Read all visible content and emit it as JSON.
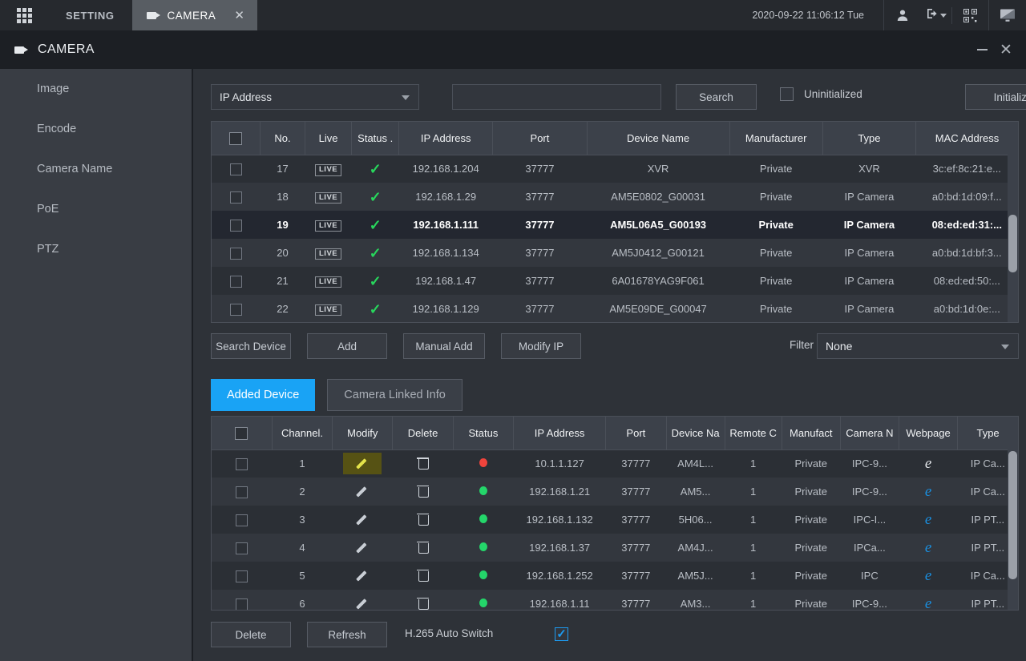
{
  "appbar": {
    "grid_icon": "grid-apps-icon",
    "setting_label": "SETTING",
    "camera_tab_label": "CAMERA",
    "camera_tab_icon": "video-camera-icon",
    "tab_close": "✕",
    "clock": "2020-09-22 11:06:12 Tue",
    "icons": [
      "user-icon",
      "logout-icon",
      "qrcode-icon",
      "display-icon"
    ]
  },
  "window": {
    "title": "CAMERA",
    "title_icon": "video-camera-icon",
    "minimize": "–",
    "close": "✕"
  },
  "sidebar": {
    "items": [
      {
        "label": "Image"
      },
      {
        "label": "Encode"
      },
      {
        "label": "Camera Name"
      },
      {
        "label": "PoE"
      },
      {
        "label": "PTZ"
      }
    ]
  },
  "search": {
    "mode_value": "IP Address",
    "input_value": "",
    "input_placeholder": "",
    "search_label": "Search",
    "uninitialized_label": "Uninitialized",
    "uninitialized_checked": false,
    "initialize_label": "Initialize"
  },
  "device_table": {
    "headers": [
      "",
      "No.",
      "Live",
      "Status .",
      "IP Address",
      "Port",
      "Device Name",
      "Manufacturer",
      "Type",
      "MAC Address"
    ],
    "rows": [
      {
        "no": "17",
        "live": "LIVE",
        "status": "✓",
        "ip": "192.168.1.204",
        "port": "37777",
        "device_name": "XVR",
        "manufacturer": "Private",
        "type": "XVR",
        "mac": "3c:ef:8c:21:e...",
        "selected": false
      },
      {
        "no": "18",
        "live": "LIVE",
        "status": "✓",
        "ip": "192.168.1.29",
        "port": "37777",
        "device_name": "AM5E0802_G00031",
        "manufacturer": "Private",
        "type": "IP Camera",
        "mac": "a0:bd:1d:09:f...",
        "selected": false
      },
      {
        "no": "19",
        "live": "LIVE",
        "status": "✓",
        "ip": "192.168.1.111",
        "port": "37777",
        "device_name": "AM5L06A5_G00193",
        "manufacturer": "Private",
        "type": "IP Camera",
        "mac": "08:ed:ed:31:...",
        "selected": true
      },
      {
        "no": "20",
        "live": "LIVE",
        "status": "✓",
        "ip": "192.168.1.134",
        "port": "37777",
        "device_name": "AM5J0412_G00121",
        "manufacturer": "Private",
        "type": "IP Camera",
        "mac": "a0:bd:1d:bf:3...",
        "selected": false
      },
      {
        "no": "21",
        "live": "LIVE",
        "status": "✓",
        "ip": "192.168.1.47",
        "port": "37777",
        "device_name": "6A01678YAG9F061",
        "manufacturer": "Private",
        "type": "IP Camera",
        "mac": "08:ed:ed:50:...",
        "selected": false
      },
      {
        "no": "22",
        "live": "LIVE",
        "status": "✓",
        "ip": "192.168.1.129",
        "port": "37777",
        "device_name": "AM5E09DE_G00047",
        "manufacturer": "Private",
        "type": "IP Camera",
        "mac": "a0:bd:1d:0e:...",
        "selected": false
      }
    ]
  },
  "mid_toolbar": {
    "search_device_label": "Search Device",
    "add_label": "Add",
    "manual_add_label": "Manual Add",
    "modify_ip_label": "Modify IP",
    "filter_label": "Filter",
    "filter_value": "None"
  },
  "tabs": {
    "added_device_label": "Added Device",
    "camera_linked_info_label": "Camera Linked Info",
    "active": "Added Device"
  },
  "added_table": {
    "headers": [
      "",
      "Channel.",
      "Modify",
      "Delete",
      "Status",
      "IP Address",
      "Port",
      "Device Na",
      "Remote C",
      "Manufact",
      "Camera N",
      "Webpage",
      "Type"
    ],
    "rows": [
      {
        "channel": "1",
        "modify": "pencil",
        "modify_highlight": true,
        "delete": "trash",
        "status": "red",
        "ip": "10.1.1.127",
        "port": "37777",
        "device_name": "AM4L...",
        "remote_ch": "1",
        "manufacturer": "Private",
        "camera_name": "IPC-9...",
        "webpage": "e",
        "webpage_color": "white",
        "type": "IP Ca..."
      },
      {
        "channel": "2",
        "modify": "pencil",
        "modify_highlight": false,
        "delete": "trash",
        "status": "green",
        "ip": "192.168.1.21",
        "port": "37777",
        "device_name": "AM5...",
        "remote_ch": "1",
        "manufacturer": "Private",
        "camera_name": "IPC-9...",
        "webpage": "e",
        "webpage_color": "blue",
        "type": "IP Ca..."
      },
      {
        "channel": "3",
        "modify": "pencil",
        "modify_highlight": false,
        "delete": "trash",
        "status": "green",
        "ip": "192.168.1.132",
        "port": "37777",
        "device_name": "5H06...",
        "remote_ch": "1",
        "manufacturer": "Private",
        "camera_name": "IPC-I...",
        "webpage": "e",
        "webpage_color": "blue",
        "type": "IP PT..."
      },
      {
        "channel": "4",
        "modify": "pencil",
        "modify_highlight": false,
        "delete": "trash",
        "status": "green",
        "ip": "192.168.1.37",
        "port": "37777",
        "device_name": "AM4J...",
        "remote_ch": "1",
        "manufacturer": "Private",
        "camera_name": "IPCa...",
        "webpage": "e",
        "webpage_color": "blue",
        "type": "IP PT..."
      },
      {
        "channel": "5",
        "modify": "pencil",
        "modify_highlight": false,
        "delete": "trash",
        "status": "green",
        "ip": "192.168.1.252",
        "port": "37777",
        "device_name": "AM5J...",
        "remote_ch": "1",
        "manufacturer": "Private",
        "camera_name": "IPC",
        "webpage": "e",
        "webpage_color": "blue",
        "type": "IP Ca..."
      },
      {
        "channel": "6",
        "modify": "pencil",
        "modify_highlight": false,
        "delete": "trash",
        "status": "green",
        "ip": "192.168.1.11",
        "port": "37777",
        "device_name": "AM3...",
        "remote_ch": "1",
        "manufacturer": "Private",
        "camera_name": "IPC-9...",
        "webpage": "e",
        "webpage_color": "blue",
        "type": "IP PT..."
      }
    ]
  },
  "bottom_toolbar": {
    "delete_label": "Delete",
    "refresh_label": "Refresh",
    "h265_label": "H.265 Auto Switch",
    "h265_checked": true
  },
  "colors": {
    "accent": "#19a3f5",
    "status_ok": "#28d65c",
    "status_offline": "#f0443c",
    "highlight_pencil": "#e4e34a"
  }
}
